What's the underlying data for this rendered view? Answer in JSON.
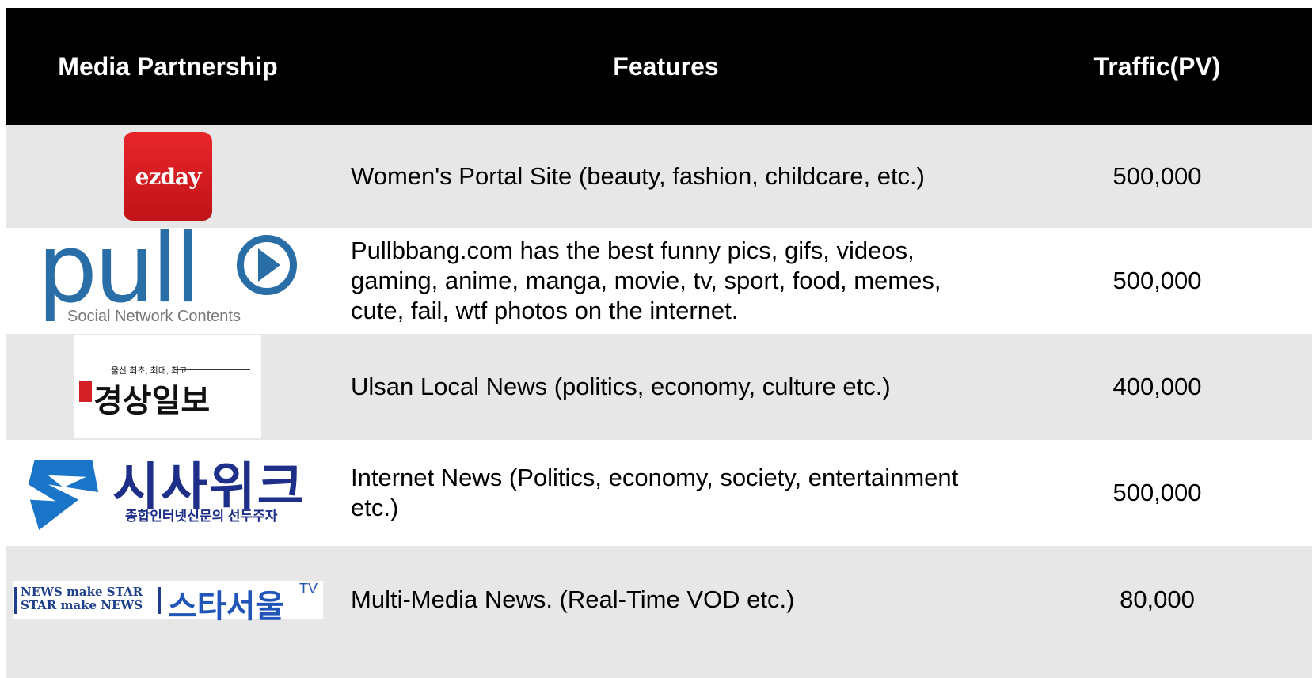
{
  "header": {
    "col1": "Media Partnership",
    "col2": "Features",
    "col3": "Traffic(PV)"
  },
  "rows": [
    {
      "logo_text": "ezday",
      "features": "Women's Portal Site (beauty, fashion, childcare, etc.)",
      "traffic": "500,000"
    },
    {
      "logo_text": "pull",
      "logo_sub": "Social Network Contents",
      "features": "Pullbbang.com has the best funny pics, gifs, videos, gaming, anime, manga, movie, tv, sport, food, memes, cute, fail, wtf photos on the internet.",
      "traffic": "500,000"
    },
    {
      "logo_top": "울산 최초, 최대, 최고",
      "logo_text": "경상일보",
      "features": "Ulsan Local News (politics, economy, culture etc.)",
      "traffic": "400,000"
    },
    {
      "logo_text": "시사위크",
      "logo_sub": "종합인터넷신문의 선두주자",
      "features": "Internet News (Politics, economy, society, entertainment etc.)",
      "traffic": "500,000"
    },
    {
      "logo_line1": "NEWS make STAR",
      "logo_line2": "STAR make NEWS",
      "logo_text": "스타서울",
      "logo_tv": "TV",
      "features": "Multi-Media News. (Real-Time VOD etc.)",
      "traffic": "80,000"
    }
  ],
  "colors": {
    "header_bg": "#000000",
    "row_gray": "#e7e7e7",
    "ezday_red": "#d71a1f",
    "pull_blue": "#2a6ea7",
    "sisa_navy": "#1d2f88"
  }
}
